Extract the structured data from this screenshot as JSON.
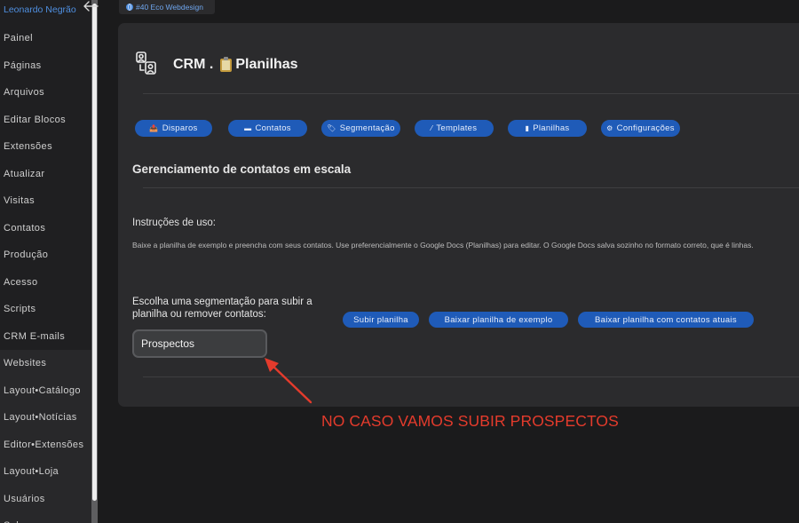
{
  "sidebar": {
    "user_name": "Leonardo Negrão",
    "items": [
      {
        "label": "Painel",
        "name": "painel"
      },
      {
        "label": "Páginas",
        "name": "paginas"
      },
      {
        "label": "Arquivos",
        "name": "arquivos"
      },
      {
        "label": "Editar Blocos",
        "name": "editar-blocos"
      },
      {
        "label": "Extensões",
        "name": "extensoes"
      },
      {
        "label": "Atualizar",
        "name": "atualizar"
      },
      {
        "label": "Visitas",
        "name": "visitas"
      },
      {
        "label": "Contatos",
        "name": "contatos"
      },
      {
        "label": "Produção",
        "name": "producao"
      },
      {
        "label": "Acesso",
        "name": "acesso"
      },
      {
        "label": "Scripts",
        "name": "scripts"
      },
      {
        "label": "CRM E-mails",
        "name": "crm-emails"
      },
      {
        "label": "Websites",
        "name": "websites"
      },
      {
        "label": "Layout•Catálogo",
        "name": "layout-catalogo"
      },
      {
        "label": "Layout•Notícias",
        "name": "layout-noticias"
      },
      {
        "label": "Editor•Extensões",
        "name": "editor-extensoes"
      },
      {
        "label": "Layout•Loja",
        "name": "layout-loja"
      },
      {
        "label": "Usuários",
        "name": "usuarios"
      },
      {
        "label": "Sobre",
        "name": "sobre"
      }
    ]
  },
  "site_tab": {
    "label": "#40 Eco Webdesign"
  },
  "header": {
    "title_prefix": "CRM .",
    "title_suffix": "Planilhas"
  },
  "nav": [
    {
      "label": "Disparos",
      "icon": "📤",
      "name": "disparos"
    },
    {
      "label": "Contatos",
      "icon": "▬",
      "name": "contatos"
    },
    {
      "label": "Segmentação",
      "icon": "🏷",
      "name": "segmentacao"
    },
    {
      "label": "Templates",
      "icon": "⁄",
      "name": "templates"
    },
    {
      "label": "Planilhas",
      "icon": "▮",
      "name": "planilhas"
    },
    {
      "label": "Configurações",
      "icon": "⚙",
      "name": "configuracoes"
    }
  ],
  "section_title": "Gerenciamento de contatos em escala",
  "instructions": {
    "label": "Instruções de uso:",
    "text": "Baixe a planilha de exemplo e preencha com seus contatos. Use preferencialmente o Google Docs (Planilhas) para editar. O Google Docs salva sozinho no formato correto, que é linhas."
  },
  "upload": {
    "choose_label": "Escolha uma segmentação para subir a planilha ou remover contatos:",
    "selected_segment": "Prospectos",
    "buttons": {
      "upload": "Subir planilha",
      "download_example": "Baixar planilha de exemplo",
      "download_current": "Baixar planilha com contatos atuais"
    }
  },
  "annotation": {
    "text": "NO CASO VAMOS SUBIR PROSPECTOS",
    "color": "#e43b2c"
  },
  "colors": {
    "accent": "#1f5bb8",
    "link": "#4f8fe0"
  }
}
